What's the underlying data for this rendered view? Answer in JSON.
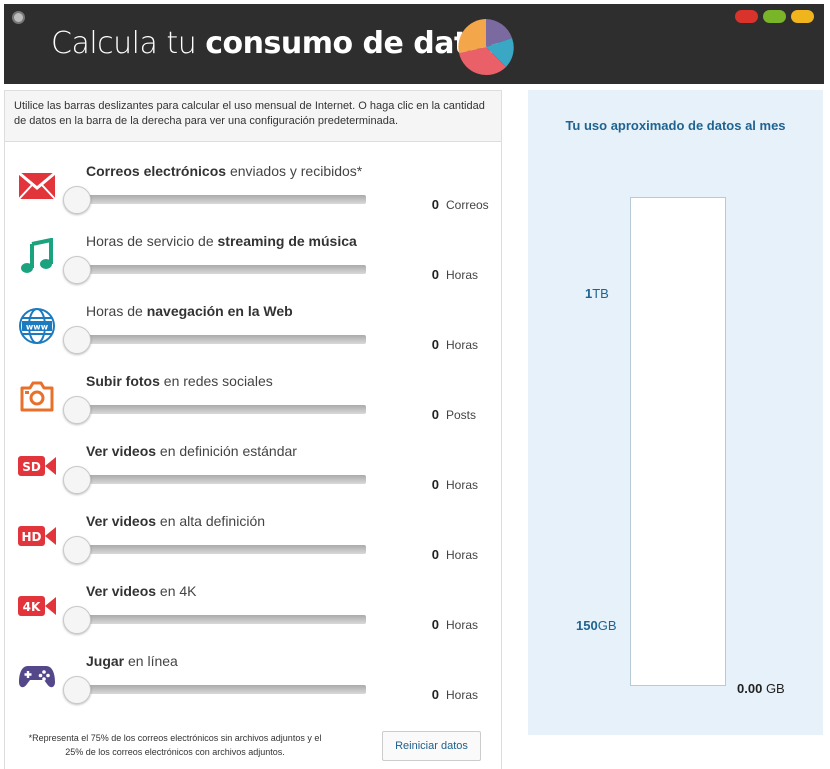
{
  "header": {
    "title_light": "Calcula tu",
    "title_bold": "consumo de datos",
    "window_colors": [
      "#d9332b",
      "#79b429",
      "#f0b41c"
    ]
  },
  "intro": "Utilice las barras deslizantes para calcular el uso mensual de Internet. O haga clic en la cantidad de datos en la barra de la derecha para ver una configuración predeterminada.",
  "rows": [
    {
      "pre": "",
      "bold": "Correos electrónicos",
      "post": " enviados y recibidos*",
      "value": "0",
      "unit": "Correos",
      "icon": "envelope-icon"
    },
    {
      "pre": "Horas de servicio de ",
      "bold": "streaming de música",
      "post": "",
      "value": "0",
      "unit": "Horas",
      "icon": "music-note-icon"
    },
    {
      "pre": "Horas de ",
      "bold": "navegación en la Web",
      "post": "",
      "value": "0",
      "unit": "Horas",
      "icon": "globe-www-icon"
    },
    {
      "pre": "",
      "bold": "Subir fotos",
      "post": " en redes sociales",
      "value": "0",
      "unit": "Posts",
      "icon": "camera-icon"
    },
    {
      "pre": "",
      "bold": "Ver videos",
      "post": " en definición estándar",
      "value": "0",
      "unit": "Horas",
      "icon": "sd-video-icon"
    },
    {
      "pre": "",
      "bold": "Ver videos",
      "post": " en alta definición",
      "value": "0",
      "unit": "Horas",
      "icon": "hd-video-icon"
    },
    {
      "pre": "",
      "bold": "Ver videos",
      "post": " en 4K",
      "value": "0",
      "unit": "Horas",
      "icon": "4k-video-icon"
    },
    {
      "pre": "",
      "bold": "Jugar",
      "post": " en línea",
      "value": "0",
      "unit": "Horas",
      "icon": "gamepad-icon"
    }
  ],
  "footnote": "*Representa el 75% de los correos electrónicos sin archivos adjuntos y el 25% de los correos electrónicos con archivos adjuntos.",
  "reset_label": "Reiniciar datos",
  "usage": {
    "title": "Tu uso aproximado de datos al mes",
    "mark_1tb_num": "1",
    "mark_1tb_unit": "TB",
    "mark_150gb_num": "150",
    "mark_150gb_unit": "GB",
    "total_value": "0.00",
    "total_unit": "GB"
  },
  "colors": {
    "accent_blue": "#1f6391",
    "panel_bg": "#e7f1f9",
    "icon_red": "#e2343b",
    "icon_green": "#1aa37e",
    "icon_blue": "#1c7bbf",
    "icon_orange": "#e8702a",
    "icon_purple": "#54488a"
  }
}
